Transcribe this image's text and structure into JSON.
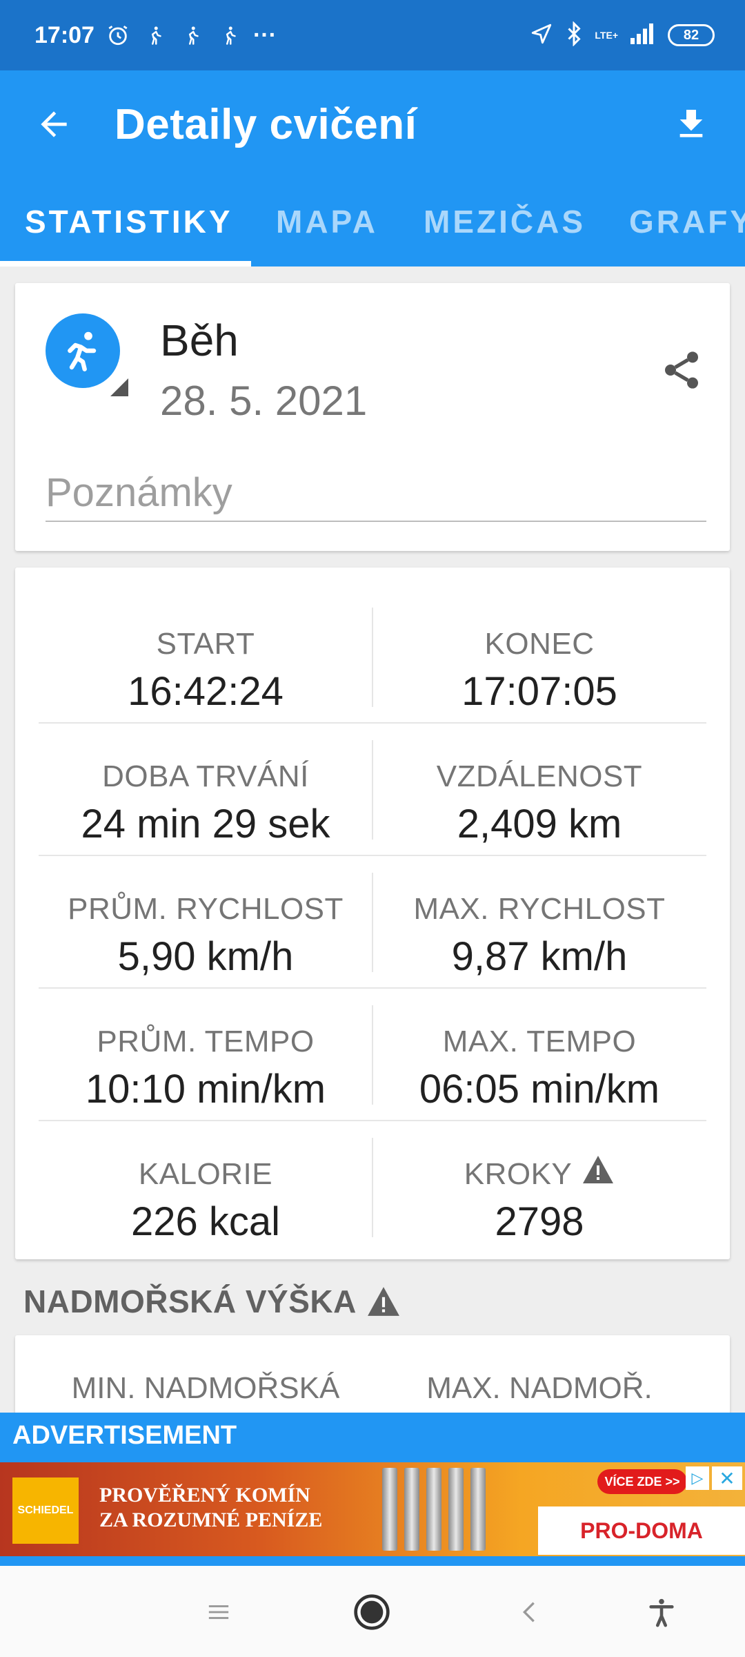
{
  "status_bar": {
    "time": "17:07",
    "more": "···",
    "network": "LTE+",
    "battery": "82"
  },
  "app_bar": {
    "title": "Detaily cvičení"
  },
  "tabs": [
    {
      "label": "STATISTIKY",
      "active": true
    },
    {
      "label": "MAPA",
      "active": false
    },
    {
      "label": "MEZIČAS",
      "active": false
    },
    {
      "label": "GRAFY",
      "active": false
    }
  ],
  "activity": {
    "name": "Běh",
    "date": "28. 5. 2021",
    "notes_placeholder": "Poznámky",
    "icon": "running-icon"
  },
  "stats": [
    {
      "left": {
        "label": "START",
        "value": "16:42:24"
      },
      "right": {
        "label": "KONEC",
        "value": "17:07:05"
      }
    },
    {
      "left": {
        "label": "DOBA TRVÁNÍ",
        "value": "24 min 29 sek"
      },
      "right": {
        "label": "VZDÁLENOST",
        "value": "2,409 km"
      }
    },
    {
      "left": {
        "label": "PRŮM. RYCHLOST",
        "value": "5,90 km/h"
      },
      "right": {
        "label": "MAX. RYCHLOST",
        "value": "9,87 km/h"
      }
    },
    {
      "left": {
        "label": "PRŮM. TEMPO",
        "value": "10:10 min/km"
      },
      "right": {
        "label": "MAX. TEMPO",
        "value": "06:05 min/km"
      }
    },
    {
      "left": {
        "label": "KALORIE",
        "value": "226 kcal"
      },
      "right": {
        "label": "KROKY",
        "value": "2798"
      }
    }
  ],
  "elevation": {
    "header": "NADMOŘSKÁ VÝŠKA",
    "left_label": "MIN. NADMOŘSKÁ",
    "right_label": "MAX. NADMOŘ."
  },
  "ad": {
    "title": "ADVERTISEMENT",
    "logo": "SCHIEDEL",
    "headline_1": "PROVĚŘENÝ KOMÍN",
    "headline_2": "ZA ROZUMNÉ PENÍZE",
    "cta": "VÍCE ZDE >>",
    "brand": "PRO-DOMA",
    "close": "✕"
  },
  "colors": {
    "primary": "#2196f3",
    "status_bar": "#1b73c9",
    "warning": "#616161"
  }
}
